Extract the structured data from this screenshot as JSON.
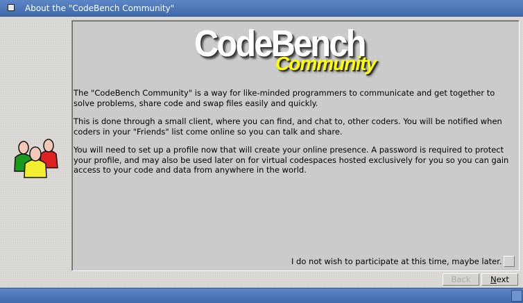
{
  "window": {
    "title": "About the \"CodeBench Community\""
  },
  "logo": {
    "main": "CodeBench",
    "sub": "Community"
  },
  "content": {
    "paragraphs": [
      "The \"CodeBench Community\" is a way for like-minded programmers to communicate and get together to solve problems, share code and swap files easily and quickly.",
      "This is done through a small client, where you can find, and chat to, other coders. You will be notified when coders in your \"Friends\" list come online so you can talk and share.",
      "You will need to set up a profile now that will create your online presence. A password is required to protect your profile, and may also be used later on for virtual codespaces hosted exclusively for you so you can gain access to your code and data from anywhere in the world."
    ]
  },
  "optout": {
    "label": "I do not wish to participate at this time, maybe later.",
    "checked": false
  },
  "buttons": {
    "back": "Back",
    "next_underlined": "N",
    "next_rest": "ext"
  },
  "icons": {
    "window_close": "close-icon",
    "community": "people-group-icon",
    "resize": "resize-icon"
  },
  "colors": {
    "titlebar": "#4f78b8",
    "logo_sub": "#ffff00",
    "person_green": "#1a9a1a",
    "person_yellow": "#f4ee30",
    "person_red": "#e02020"
  }
}
